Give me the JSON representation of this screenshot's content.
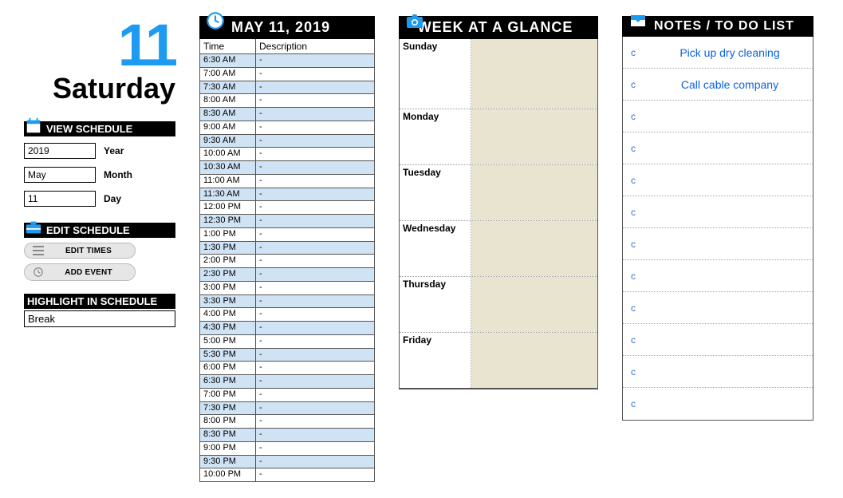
{
  "accent_color": "#1e9bf0",
  "date": {
    "number": "11",
    "weekday": "Saturday",
    "full_label": "MAY 11,  2019"
  },
  "view_schedule": {
    "title": "VIEW SCHEDULE",
    "year_label": "Year",
    "month_label": "Month",
    "day_label": "Day",
    "year_value": "2019",
    "month_value": "May",
    "day_value": "11"
  },
  "edit_schedule": {
    "title": "EDIT SCHEDULE",
    "edit_times_label": "EDIT TIMES",
    "add_event_label": "ADD  EVENT"
  },
  "highlight": {
    "title": "HIGHLIGHT IN SCHEDULE",
    "value": "Break"
  },
  "schedule": {
    "col_time": "Time",
    "col_desc": "Description",
    "rows": [
      {
        "time": "6:30 AM",
        "desc": "-"
      },
      {
        "time": "7:00 AM",
        "desc": "-"
      },
      {
        "time": "7:30 AM",
        "desc": "-"
      },
      {
        "time": "8:00 AM",
        "desc": "-"
      },
      {
        "time": "8:30 AM",
        "desc": "-"
      },
      {
        "time": "9:00 AM",
        "desc": "-"
      },
      {
        "time": "9:30 AM",
        "desc": "-"
      },
      {
        "time": "10:00 AM",
        "desc": "-"
      },
      {
        "time": "10:30 AM",
        "desc": "-"
      },
      {
        "time": "11:00 AM",
        "desc": "-"
      },
      {
        "time": "11:30 AM",
        "desc": "-"
      },
      {
        "time": "12:00 PM",
        "desc": "-"
      },
      {
        "time": "12:30 PM",
        "desc": "-"
      },
      {
        "time": "1:00 PM",
        "desc": "-"
      },
      {
        "time": "1:30 PM",
        "desc": "-"
      },
      {
        "time": "2:00 PM",
        "desc": "-"
      },
      {
        "time": "2:30 PM",
        "desc": "-"
      },
      {
        "time": "3:00 PM",
        "desc": "-"
      },
      {
        "time": "3:30 PM",
        "desc": "-"
      },
      {
        "time": "4:00 PM",
        "desc": "-"
      },
      {
        "time": "4:30 PM",
        "desc": "-"
      },
      {
        "time": "5:00 PM",
        "desc": "-"
      },
      {
        "time": "5:30 PM",
        "desc": "-"
      },
      {
        "time": "6:00 PM",
        "desc": "-"
      },
      {
        "time": "6:30 PM",
        "desc": "-"
      },
      {
        "time": "7:00 PM",
        "desc": "-"
      },
      {
        "time": "7:30 PM",
        "desc": "-"
      },
      {
        "time": "8:00 PM",
        "desc": "-"
      },
      {
        "time": "8:30 PM",
        "desc": "-"
      },
      {
        "time": "9:00 PM",
        "desc": "-"
      },
      {
        "time": "9:30 PM",
        "desc": "-"
      },
      {
        "time": "10:00 PM",
        "desc": "-"
      }
    ]
  },
  "week": {
    "title": "WEEK AT A GLANCE",
    "days": [
      {
        "label": "Sunday"
      },
      {
        "label": "Monday"
      },
      {
        "label": "Tuesday"
      },
      {
        "label": "Wednesday"
      },
      {
        "label": "Thursday"
      },
      {
        "label": "Friday"
      }
    ]
  },
  "notes": {
    "title": "NOTES / TO DO LIST",
    "bullet": "c",
    "rows": [
      {
        "text": "Pick up dry cleaning"
      },
      {
        "text": "Call cable company"
      },
      {
        "text": ""
      },
      {
        "text": ""
      },
      {
        "text": ""
      },
      {
        "text": ""
      },
      {
        "text": ""
      },
      {
        "text": ""
      },
      {
        "text": ""
      },
      {
        "text": ""
      },
      {
        "text": ""
      },
      {
        "text": ""
      }
    ]
  }
}
